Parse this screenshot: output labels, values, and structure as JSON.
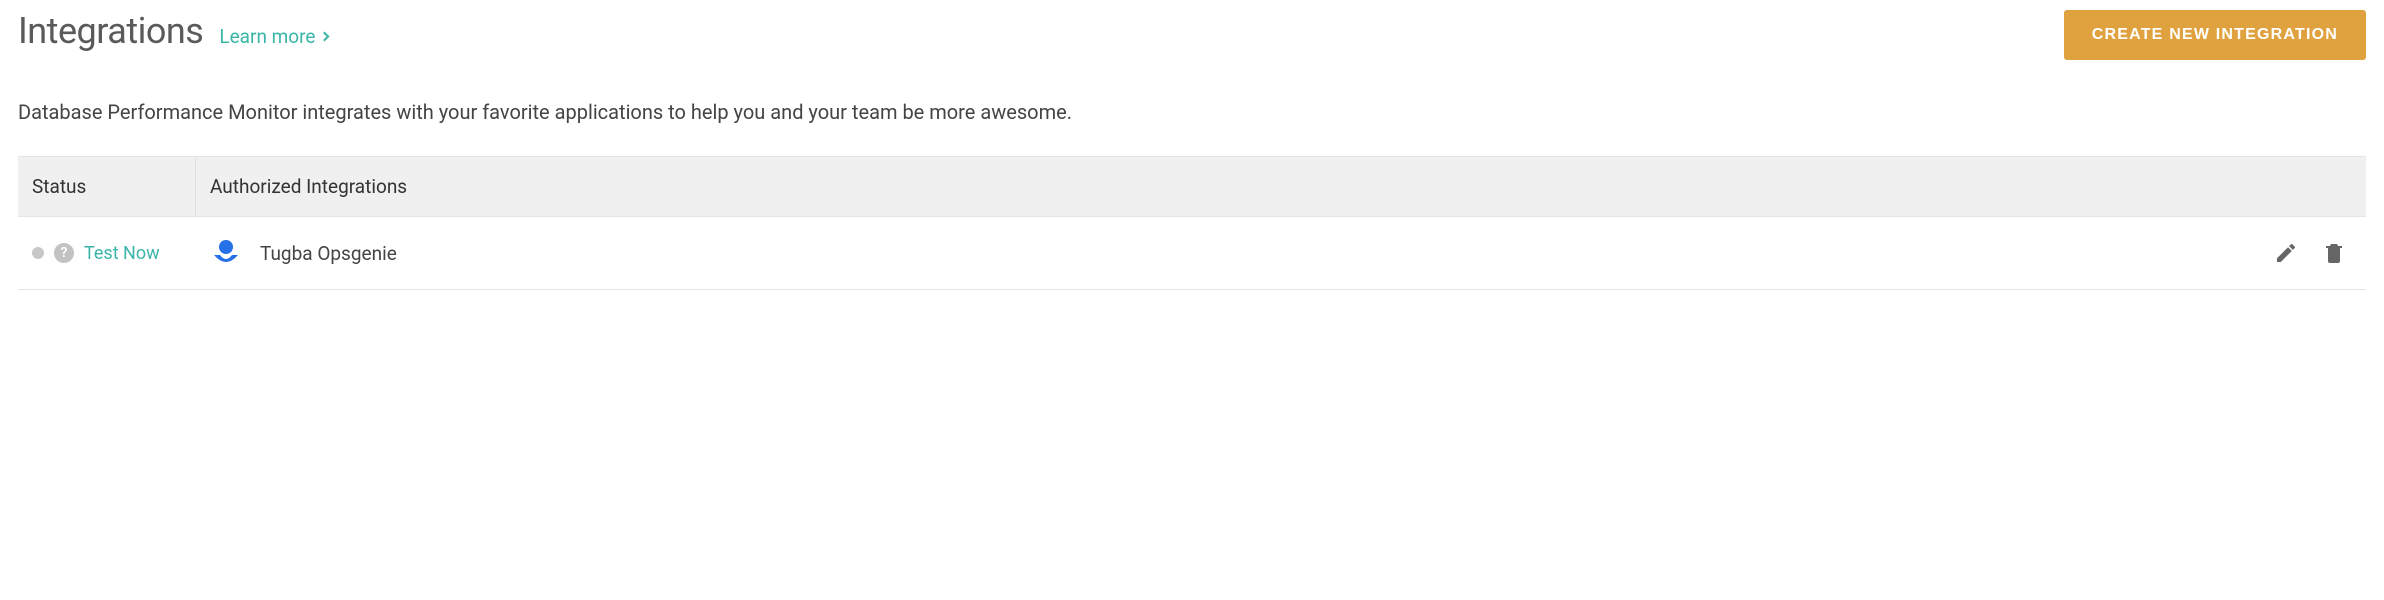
{
  "header": {
    "title": "Integrations",
    "learn_more_label": "Learn more",
    "create_button_label": "CREATE NEW INTEGRATION"
  },
  "description": "Database Performance Monitor integrates with your favorite applications to help you and your team be more awesome.",
  "table": {
    "columns": {
      "status": "Status",
      "authorized": "Authorized Integrations"
    },
    "rows": [
      {
        "test_now_label": "Test Now",
        "integration_name": "Tugba Opsgenie",
        "integration_icon": "opsgenie-icon",
        "status_color": "#c7c7c7"
      }
    ]
  }
}
